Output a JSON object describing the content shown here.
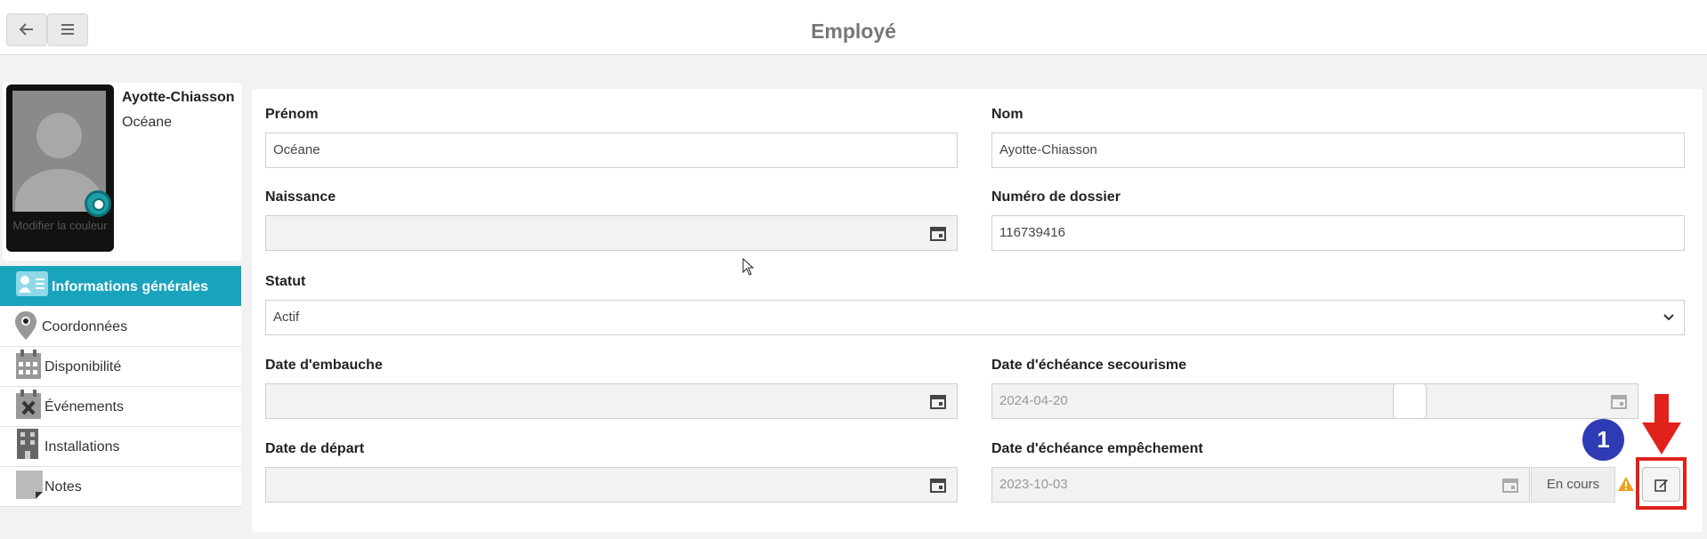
{
  "header": {
    "title": "Employé",
    "back_icon": "arrow-left-icon",
    "menu_icon": "hamburger-icon"
  },
  "profile": {
    "last_name": "Ayotte-Chiasson",
    "first_name": "Océane",
    "photo_caption": "Modifier la couleur"
  },
  "nav": {
    "items": [
      {
        "label": "Informations générales",
        "icon": "id-card-icon",
        "active": true
      },
      {
        "label": "Coordonnées",
        "icon": "map-pin-icon",
        "active": false
      },
      {
        "label": "Disponibilité",
        "icon": "calendar-icon",
        "active": false
      },
      {
        "label": "Événements",
        "icon": "calendar-x-icon",
        "active": false
      },
      {
        "label": "Installations",
        "icon": "building-icon",
        "active": false
      },
      {
        "label": "Notes",
        "icon": "note-icon",
        "active": false
      }
    ]
  },
  "form": {
    "prenom": {
      "label": "Prénom",
      "value": "Océane"
    },
    "nom": {
      "label": "Nom",
      "value": "Ayotte-Chiasson"
    },
    "naissance": {
      "label": "Naissance",
      "value": ""
    },
    "dossier": {
      "label": "Numéro de dossier",
      "value": "116739416"
    },
    "statut": {
      "label": "Statut",
      "value": "Actif"
    },
    "embauche": {
      "label": "Date d'embauche",
      "value": ""
    },
    "secourisme": {
      "label": "Date d'échéance secourisme",
      "value": "2024-04-20"
    },
    "depart": {
      "label": "Date de départ",
      "value": ""
    },
    "empechement": {
      "label": "Date d'échéance empêchement",
      "value": "2023-10-03",
      "status": "En cours"
    }
  },
  "annotation": {
    "step_number": "1",
    "color": "#e0211c",
    "badge_color": "#2f3bb5"
  },
  "colors": {
    "accent": "#1aa3bd",
    "warning": "#f0a020"
  }
}
